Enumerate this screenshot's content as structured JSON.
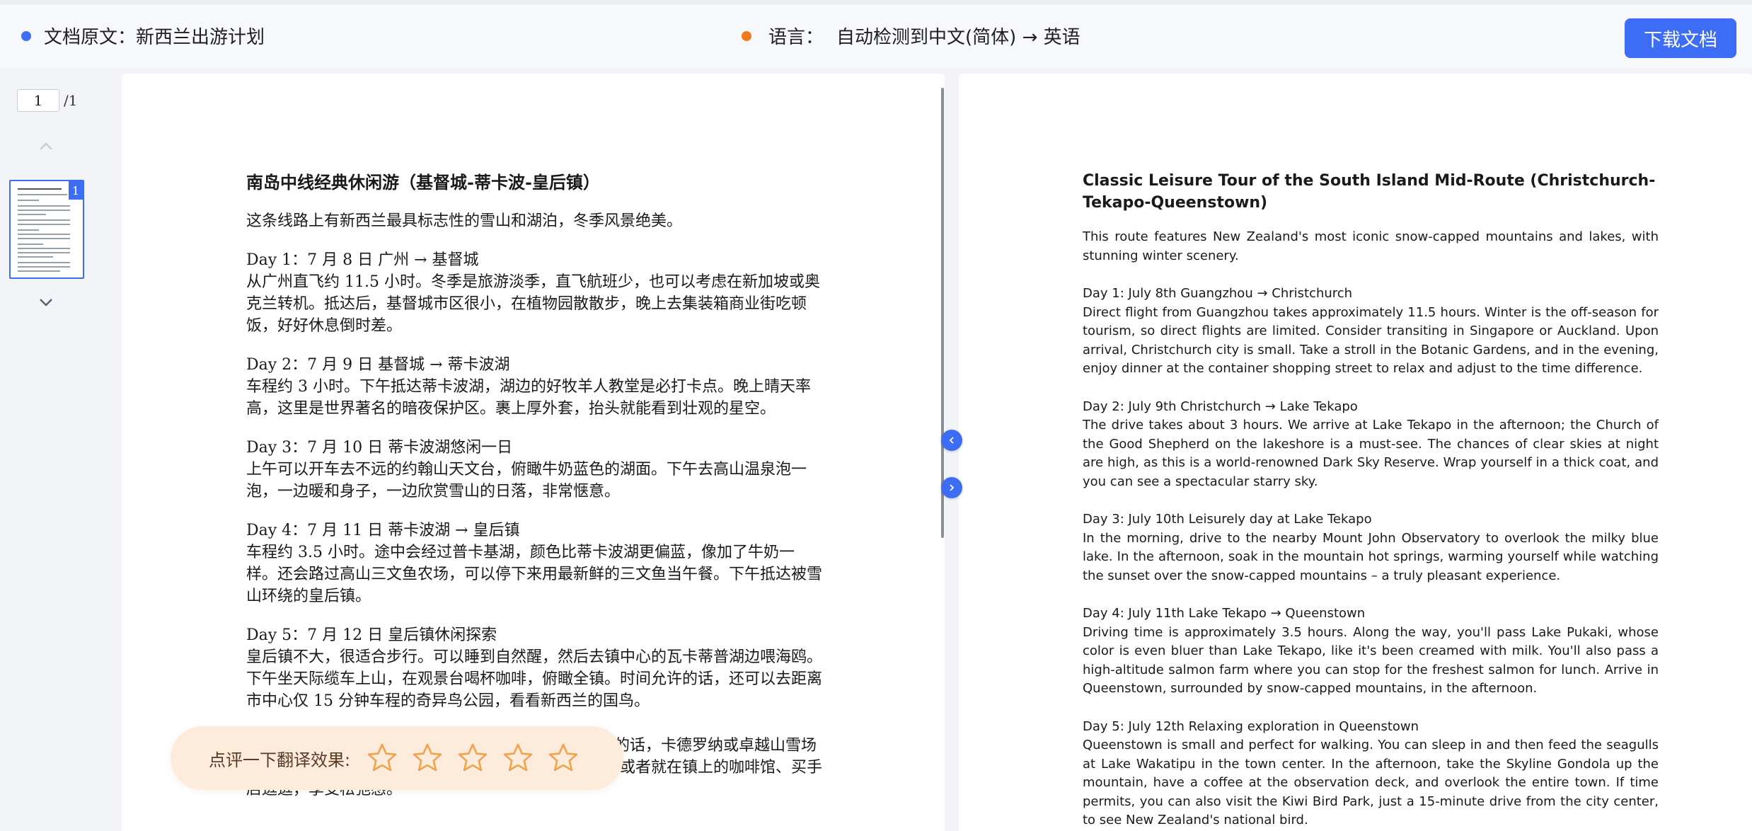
{
  "header": {
    "source_label": "文档原文：",
    "source_name": "新西兰出游计划",
    "language_label": "语言：",
    "language_value": "自动检测到中文(简体) → 英语",
    "download_label": "下载文档",
    "colors": {
      "source_dot": "#3e6df5",
      "language_dot": "#f07b1e",
      "accent": "#3e6df5"
    }
  },
  "pager": {
    "current": "1",
    "total": "/1",
    "thumb_badge": "1"
  },
  "source_doc": {
    "title": "南岛中线经典休闲游（基督城-蒂卡波-皇后镇）",
    "intro": "这条线路上有新西兰最具标志性的雪山和湖泊，冬季风景绝美。",
    "days": [
      {
        "heading": "Day 1：7 月 8 日  广州 → 基督城",
        "body": "从广州直飞约 11.5 小时。冬季是旅游淡季，直飞航班少，也可以考虑在新加坡或奥克兰转机。抵达后，基督城市区很小，在植物园散散步，晚上去集装箱商业街吃顿饭，好好休息倒时差。"
      },
      {
        "heading": "Day 2：7 月 9 日  基督城 → 蒂卡波湖",
        "body": "车程约 3 小时。下午抵达蒂卡波湖，湖边的好牧羊人教堂是必打卡点。晚上晴天率高，这里是世界著名的暗夜保护区。裹上厚外套，抬头就能看到壮观的星空。"
      },
      {
        "heading": "Day 3：7 月 10 日  蒂卡波湖悠闲一日",
        "body": "上午可以开车去不远的约翰山天文台，俯瞰牛奶蓝色的湖面。下午去高山温泉泡一泡，一边暖和身子，一边欣赏雪山的日落，非常惬意。"
      },
      {
        "heading": "Day 4：7 月 11 日  蒂卡波湖 → 皇后镇",
        "body": "车程约 3.5 小时。途中会经过普卡基湖，颜色比蒂卡波湖更偏蓝，像加了牛奶一样。还会路过高山三文鱼农场，可以停下来用最新鲜的三文鱼当午餐。下午抵达被雪山环绕的皇后镇。"
      },
      {
        "heading": "Day 5：7 月 12 日  皇后镇休闲探索",
        "body": "皇后镇不大，很适合步行。可以睡到自然醒，然后去镇中心的瓦卡蒂普湖边喂海鸥。下午坐天际缆车上山，在观景台喝杯咖啡，俯瞰全镇。时间允许的话，还可以去距离市中心仅 15 分钟车程的奇异鸟公园，看看新西兰的国鸟。"
      },
      {
        "heading": "",
        "body": "的话，卡德罗纳或卓越山雪场都很好；想更轻松，可以去吉布斯顿酒庄品尝黑皮诺；或者就在镇上的咖啡馆、买手店逛逛，享受松弛感。"
      }
    ]
  },
  "target_doc": {
    "title": "Classic Leisure Tour of the South Island Mid-Route (Christchurch-Tekapo-Queenstown)",
    "intro": "This route features New Zealand's most iconic snow-capped mountains and lakes, with stunning winter scenery.",
    "days": [
      {
        "heading": "Day 1: July 8th Guangzhou → Christchurch",
        "body": "Direct flight from Guangzhou takes approximately 11.5 hours. Winter is the off-season for tourism, so direct flights are limited. Consider transiting in Singapore or Auckland. Upon arrival, Christchurch city is small. Take a stroll in the Botanic Gardens, and in the evening, enjoy dinner at the container shopping street to relax and adjust to the time difference."
      },
      {
        "heading": "Day 2: July 9th Christchurch → Lake Tekapo",
        "body": "The drive takes about 3 hours. We arrive at Lake Tekapo in the afternoon; the Church of the Good Shepherd on the lakeshore is a must-see. The chances of clear skies at night are high, as this is a world-renowned Dark Sky Reserve. Wrap yourself in a thick coat, and you can see a spectacular starry sky."
      },
      {
        "heading": "Day 3: July 10th Leisurely day at Lake Tekapo",
        "body": "In the morning, drive to the nearby Mount John Observatory to overlook the milky blue lake. In the afternoon, soak in the mountain hot springs, warming yourself while watching the sunset over the snow-capped mountains – a truly pleasant experience."
      },
      {
        "heading": "Day 4: July 11th Lake Tekapo → Queenstown",
        "body": "Driving time is approximately 3.5 hours. Along the way, you'll pass Lake Pukaki, whose color is even bluer than Lake Tekapo, like it's been creamed with milk. You'll also pass a high-altitude salmon farm where you can stop for the freshest salmon for lunch. Arrive in Queenstown, surrounded by snow-capped mountains, in the afternoon."
      },
      {
        "heading": "Day 5: July 12th Relaxing exploration in Queenstown",
        "body": "Queenstown is small and perfect for walking. You can sleep in and then feed the seagulls at Lake Wakatipu in the town center. In the afternoon, take the Skyline Gondola up the mountain, have a coffee at the observation deck, and overlook the entire town. If time permits, you can also visit the Kiwi Bird Park, just a 15-minute drive from the city center, to see New Zealand's national bird."
      }
    ]
  },
  "rating": {
    "label": "点评一下翻译效果:",
    "max_stars": 5,
    "star_color": "#f2a24a"
  },
  "icons": [
    "chevron-up-icon",
    "chevron-down-icon",
    "chevron-left-icon",
    "chevron-right-icon",
    "star-icon"
  ]
}
